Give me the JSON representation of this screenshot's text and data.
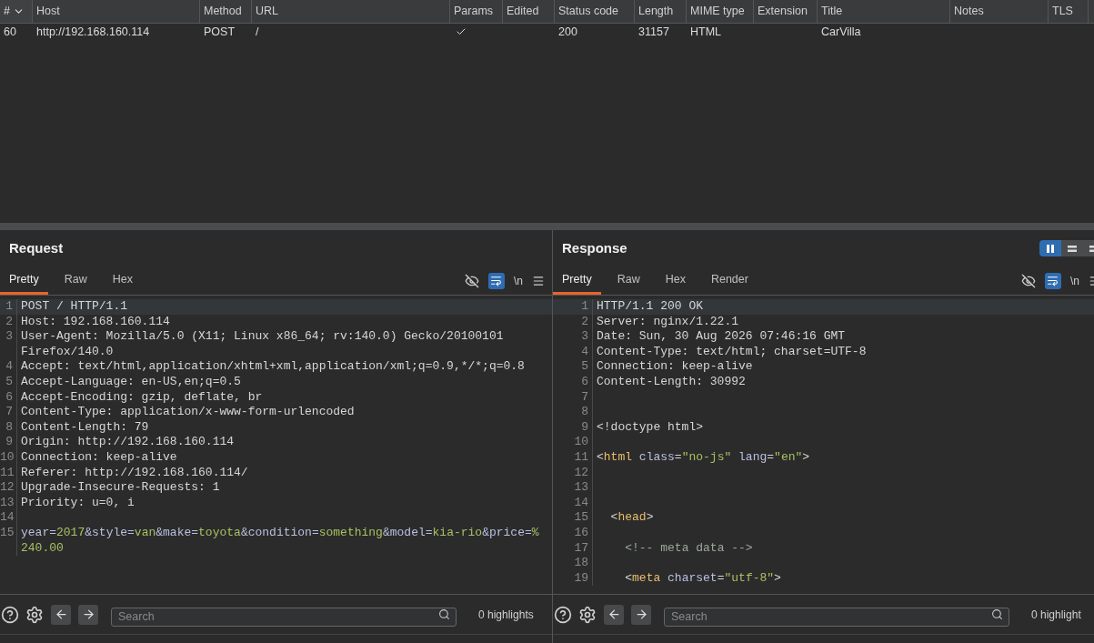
{
  "table": {
    "columns": [
      {
        "label": "#",
        "sorted": true
      },
      {
        "label": "Host",
        "sorted": false
      },
      {
        "label": "Method",
        "sorted": false
      },
      {
        "label": "URL",
        "sorted": false
      },
      {
        "label": "Params",
        "sorted": false
      },
      {
        "label": "Edited",
        "sorted": false
      },
      {
        "label": "Status code",
        "sorted": false
      },
      {
        "label": "Length",
        "sorted": false
      },
      {
        "label": "MIME type",
        "sorted": false
      },
      {
        "label": "Extension",
        "sorted": false
      },
      {
        "label": "Title",
        "sorted": false
      },
      {
        "label": "Notes",
        "sorted": false
      },
      {
        "label": "TLS",
        "sorted": false
      }
    ],
    "rows": [
      {
        "number": "60",
        "host": "http://192.168.160.114",
        "method": "POST",
        "url": "/",
        "params": true,
        "status_code": "200",
        "length": "31157",
        "mime_type": "HTML",
        "title": "CarVilla"
      }
    ]
  },
  "request": {
    "title": "Request",
    "tabs": [
      {
        "label": "Pretty",
        "selected": true
      },
      {
        "label": "Raw",
        "selected": false
      },
      {
        "label": "Hex",
        "selected": false
      }
    ],
    "word_wrap": true,
    "newline_toggle": "\\n",
    "lines": [
      {
        "number": "1",
        "selected": true,
        "segments": [
          {
            "kind": "plain",
            "text": "POST / HTTP/1.1"
          }
        ]
      },
      {
        "number": "2",
        "selected": false,
        "segments": [
          {
            "kind": "plain",
            "text": "Host: 192.168.160.114"
          }
        ]
      },
      {
        "number": "3",
        "selected": false,
        "segments": [
          {
            "kind": "plain",
            "text": "User-Agent: Mozilla/5.0 (X11; Linux x86_64; rv:140.0) Gecko/20100101 Firefox/140.0"
          }
        ]
      },
      {
        "number": "4",
        "selected": false,
        "segments": [
          {
            "kind": "plain",
            "text": "Accept: text/html,application/xhtml+xml,application/xml;q=0.9,*/*;q=0.8"
          }
        ]
      },
      {
        "number": "5",
        "selected": false,
        "segments": [
          {
            "kind": "plain",
            "text": "Accept-Language: en-US,en;q=0.5"
          }
        ]
      },
      {
        "number": "6",
        "selected": false,
        "segments": [
          {
            "kind": "plain",
            "text": "Accept-Encoding: gzip, deflate, br"
          }
        ]
      },
      {
        "number": "7",
        "selected": false,
        "segments": [
          {
            "kind": "plain",
            "text": "Content-Type: application/x-www-form-urlencoded"
          }
        ]
      },
      {
        "number": "8",
        "selected": false,
        "segments": [
          {
            "kind": "plain",
            "text": "Content-Length: 79"
          }
        ]
      },
      {
        "number": "9",
        "selected": false,
        "segments": [
          {
            "kind": "plain",
            "text": "Origin: http://192.168.160.114"
          }
        ]
      },
      {
        "number": "10",
        "selected": false,
        "segments": [
          {
            "kind": "plain",
            "text": "Connection: keep-alive"
          }
        ]
      },
      {
        "number": "11",
        "selected": false,
        "segments": [
          {
            "kind": "plain",
            "text": "Referer: http://192.168.160.114/"
          }
        ]
      },
      {
        "number": "12",
        "selected": false,
        "segments": [
          {
            "kind": "plain",
            "text": "Upgrade-Insecure-Requests: 1"
          }
        ]
      },
      {
        "number": "13",
        "selected": false,
        "segments": [
          {
            "kind": "plain",
            "text": "Priority: u=0, i"
          }
        ]
      },
      {
        "number": "14",
        "selected": false
      },
      {
        "number": "15",
        "selected": false,
        "segments": [
          {
            "kind": "key",
            "text": "year="
          },
          {
            "kind": "value",
            "text": "2017"
          },
          {
            "kind": "key",
            "text": "&style="
          },
          {
            "kind": "value",
            "text": "van"
          },
          {
            "kind": "key",
            "text": "&make="
          },
          {
            "kind": "value",
            "text": "toyota"
          },
          {
            "kind": "key",
            "text": "&condition="
          },
          {
            "kind": "value",
            "text": "something"
          },
          {
            "kind": "key",
            "text": "&model="
          },
          {
            "kind": "value",
            "text": "kia-rio"
          },
          {
            "kind": "key",
            "text": "&price="
          },
          {
            "kind": "value",
            "text": "%240.00"
          }
        ]
      }
    ],
    "search": {
      "placeholder": "Search"
    },
    "highlights": "0 highlights"
  },
  "response": {
    "title": "Response",
    "layout_modes": [
      {
        "selected": true
      },
      {
        "selected": false
      },
      {
        "selected": false
      }
    ],
    "tabs": [
      {
        "label": "Pretty",
        "selected": true
      },
      {
        "label": "Raw",
        "selected": false
      },
      {
        "label": "Hex",
        "selected": false
      },
      {
        "label": "Render",
        "selected": false
      }
    ],
    "word_wrap": true,
    "newline_toggle": "\\n",
    "lines": [
      {
        "number": "1",
        "selected": true,
        "segments": [
          {
            "kind": "plain",
            "text": "HTTP/1.1 200 OK"
          }
        ]
      },
      {
        "number": "2",
        "selected": false,
        "segments": [
          {
            "kind": "plain",
            "text": "Server: nginx/1.22.1"
          }
        ]
      },
      {
        "number": "3",
        "selected": false,
        "segments": [
          {
            "kind": "plain",
            "text": "Date: Sun, 30 Aug 2026 07:46:16 GMT"
          }
        ]
      },
      {
        "number": "4",
        "selected": false,
        "segments": [
          {
            "kind": "plain",
            "text": "Content-Type: text/html; charset=UTF-8"
          }
        ]
      },
      {
        "number": "5",
        "selected": false,
        "segments": [
          {
            "kind": "plain",
            "text": "Connection: keep-alive"
          }
        ]
      },
      {
        "number": "6",
        "selected": false,
        "segments": [
          {
            "kind": "plain",
            "text": "Content-Length: 30992"
          }
        ]
      },
      {
        "number": "7",
        "selected": false
      },
      {
        "number": "8",
        "selected": false
      },
      {
        "number": "9",
        "selected": false,
        "segments": [
          {
            "kind": "plain",
            "text": "<!doctype html>"
          }
        ]
      },
      {
        "number": "10",
        "selected": false
      },
      {
        "number": "11",
        "selected": false,
        "segments": [
          {
            "kind": "plain",
            "text": "<"
          },
          {
            "kind": "tag",
            "text": "html"
          },
          {
            "kind": "attr",
            "text": " class"
          },
          {
            "kind": "plain",
            "text": "="
          },
          {
            "kind": "string",
            "text": "\"no-js\""
          },
          {
            "kind": "attr",
            "text": " lang"
          },
          {
            "kind": "plain",
            "text": "="
          },
          {
            "kind": "string",
            "text": "\"en\""
          },
          {
            "kind": "plain",
            "text": ">"
          }
        ]
      },
      {
        "number": "12",
        "selected": false
      },
      {
        "number": "13",
        "selected": false
      },
      {
        "number": "14",
        "selected": false
      },
      {
        "number": "15",
        "selected": false,
        "segments": [
          {
            "kind": "plain",
            "text": "  <"
          },
          {
            "kind": "tag",
            "text": "head"
          },
          {
            "kind": "plain",
            "text": ">"
          }
        ]
      },
      {
        "number": "16",
        "selected": false
      },
      {
        "number": "17",
        "selected": false,
        "segments": [
          {
            "kind": "comment",
            "text": "    <!-- meta data -->"
          }
        ]
      },
      {
        "number": "18",
        "selected": false
      },
      {
        "number": "19",
        "selected": false,
        "segments": [
          {
            "kind": "plain",
            "text": "    <"
          },
          {
            "kind": "tag",
            "text": "meta"
          },
          {
            "kind": "attr",
            "text": " charset"
          },
          {
            "kind": "plain",
            "text": "="
          },
          {
            "kind": "string",
            "text": "\"utf-8\""
          },
          {
            "kind": "plain",
            "text": ">"
          }
        ]
      }
    ],
    "search": {
      "placeholder": "Search"
    },
    "highlights": "0 highlight"
  }
}
